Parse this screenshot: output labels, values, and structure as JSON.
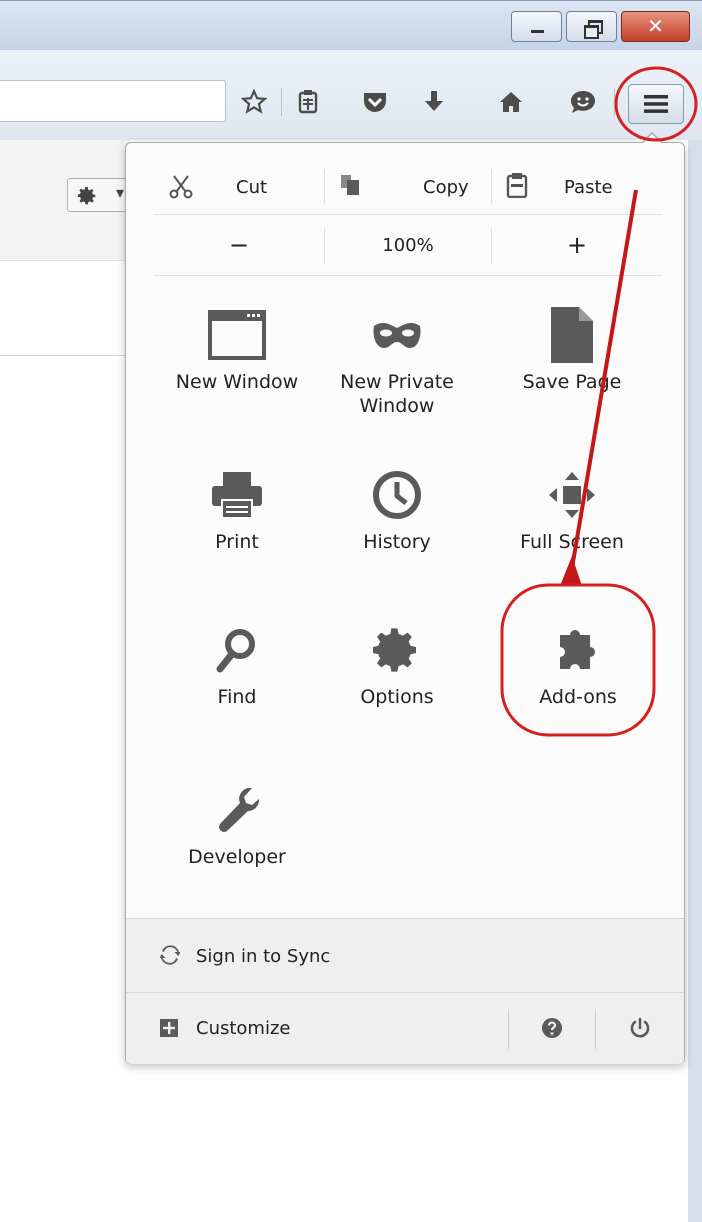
{
  "window": {
    "minimize_glyph": "",
    "maximize_glyph": "",
    "close_glyph": "✕"
  },
  "toolbar": {
    "icons": [
      "star-icon",
      "reading-list-icon",
      "pocket-icon",
      "download-icon",
      "home-icon",
      "hello-chat-icon",
      "hamburger-menu-icon"
    ]
  },
  "menu": {
    "edit": {
      "cut": "Cut",
      "copy": "Copy",
      "paste": "Paste"
    },
    "zoom": {
      "out": "−",
      "level": "100%",
      "in": "+"
    },
    "items": [
      {
        "label": "New Window",
        "icon": "new-window-icon"
      },
      {
        "label": "New Private\nWindow",
        "icon": "private-mask-icon"
      },
      {
        "label": "Save Page",
        "icon": "save-page-icon"
      },
      {
        "label": "Print",
        "icon": "print-icon"
      },
      {
        "label": "History",
        "icon": "history-clock-icon"
      },
      {
        "label": "Full Screen",
        "icon": "fullscreen-arrows-icon"
      },
      {
        "label": "Find",
        "icon": "find-magnifier-icon"
      },
      {
        "label": "Options",
        "icon": "options-gear-icon"
      },
      {
        "label": "Add-ons",
        "icon": "addons-puzzle-icon"
      },
      {
        "label": "Developer",
        "icon": "developer-wrench-icon"
      }
    ],
    "sync": "Sign in to Sync",
    "customize": "Customize"
  },
  "colors": {
    "annotation_red": "#d42020",
    "icon_gray": "#5a5a5a"
  }
}
